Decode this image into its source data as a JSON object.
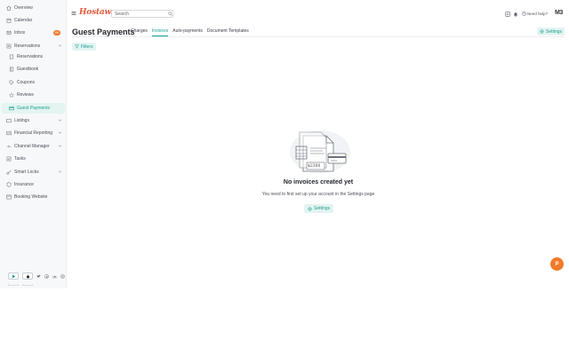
{
  "sidebar": {
    "items": [
      {
        "label": "Overview",
        "icon": "home-icon"
      },
      {
        "label": "Calendar",
        "icon": "calendar-icon"
      },
      {
        "label": "Inbox",
        "icon": "inbox-icon",
        "badge": "99"
      },
      {
        "label": "Reservations",
        "icon": "reservations-icon"
      },
      {
        "label": "Reservations",
        "icon": "list-icon"
      },
      {
        "label": "Guestbook",
        "icon": "book-icon"
      },
      {
        "label": "Coupons",
        "icon": "tag-icon"
      },
      {
        "label": "Reviews",
        "icon": "star-icon"
      },
      {
        "label": "Guest Payments",
        "icon": "card-icon"
      },
      {
        "label": "Listings",
        "icon": "listing-icon"
      },
      {
        "label": "Financial Reporting",
        "icon": "chart-icon"
      },
      {
        "label": "Channel Manager",
        "icon": "channel-icon"
      },
      {
        "label": "Tasks",
        "icon": "tasks-icon"
      },
      {
        "label": "Smart Locks",
        "icon": "key-icon"
      },
      {
        "label": "Insurance",
        "icon": "shield-icon"
      },
      {
        "label": "Booking Website",
        "icon": "globe-icon"
      }
    ]
  },
  "topbar": {
    "logo": "Hostaway",
    "search_placeholder": "Search",
    "help_label": "Need help?",
    "brand_mark": "M3"
  },
  "page": {
    "title": "Guest Payments",
    "tabs": [
      {
        "label": "Charges"
      },
      {
        "label": "Invoices"
      },
      {
        "label": "Auto-payments"
      },
      {
        "label": "Document Templates"
      }
    ],
    "settings_label": "Settings",
    "filters_label": "Filters"
  },
  "empty": {
    "illustration_amount": "$2300",
    "title": "No invoices created yet",
    "subtitle": "You need to first set up your account in the Settings page",
    "button_label": "Settings"
  },
  "fab": {
    "label": "P"
  },
  "colors": {
    "accent": "#1a9e8f",
    "accent_bg": "#e3f4f1",
    "badge": "#f07b2a",
    "logo": "#e35a3c"
  }
}
